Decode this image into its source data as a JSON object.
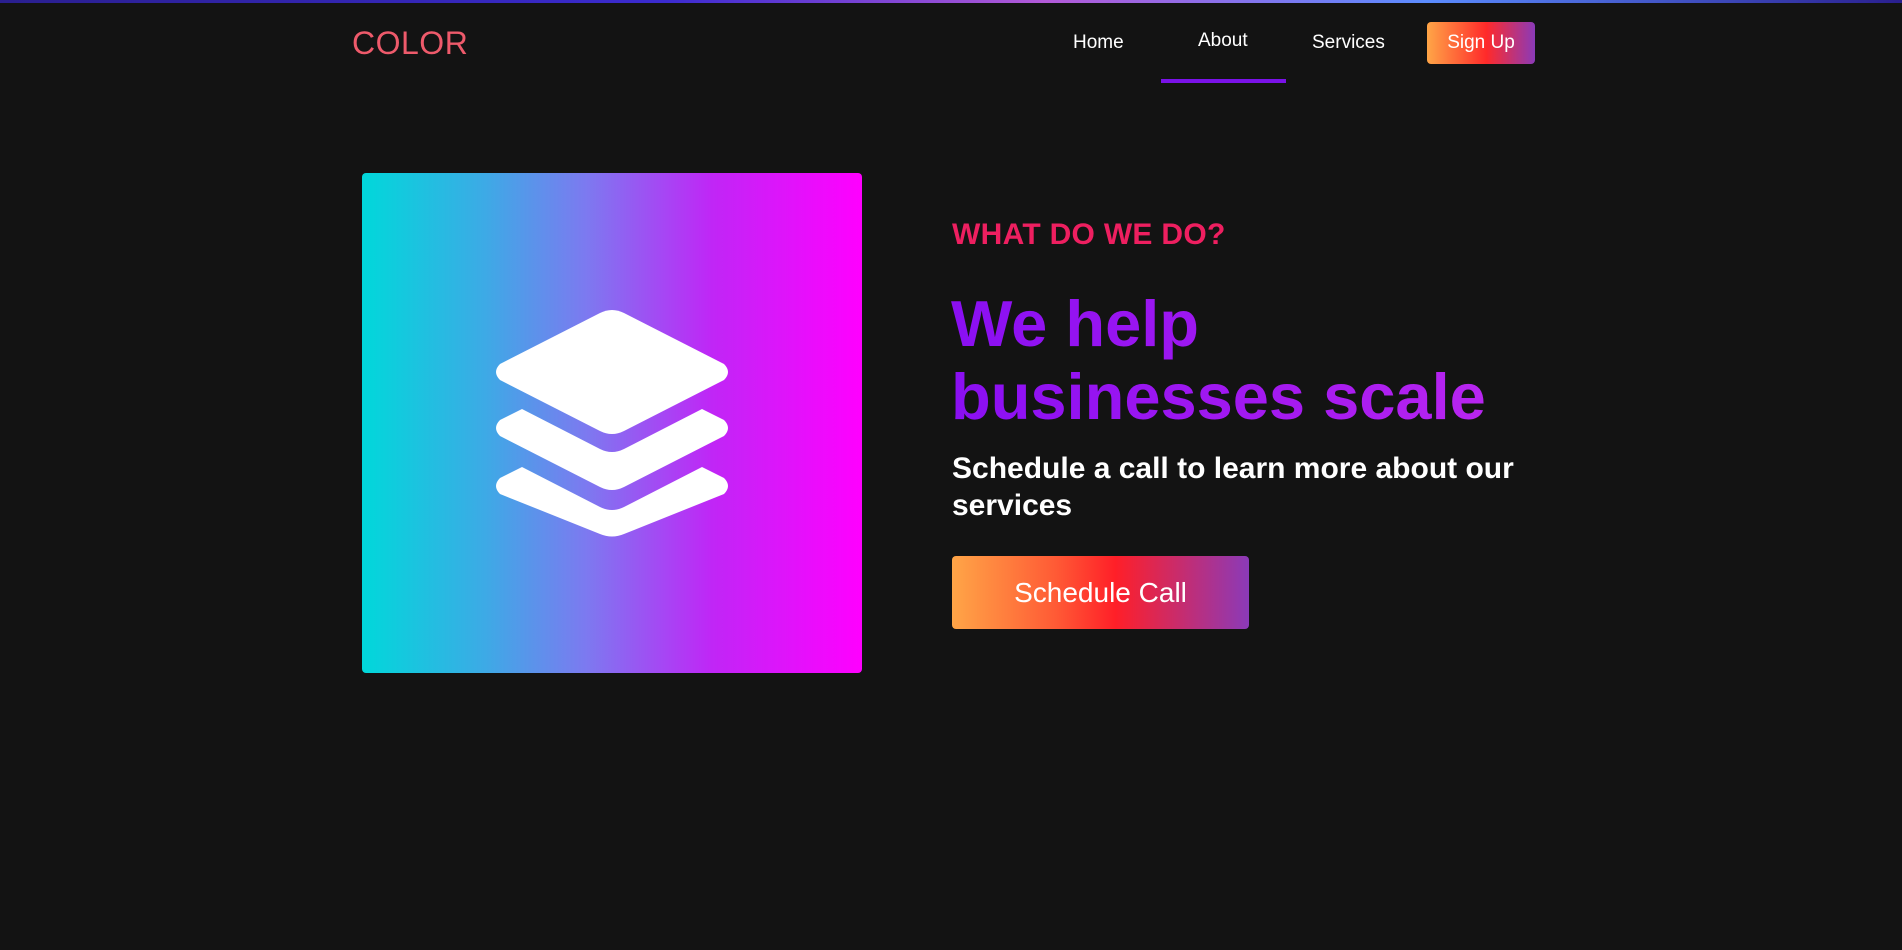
{
  "brand": {
    "logo_text": "COLOR",
    "logo_color": "#ee5a6b"
  },
  "nav": {
    "items": [
      {
        "label": "Home",
        "active": false
      },
      {
        "label": "About",
        "active": true
      },
      {
        "label": "Services",
        "active": false
      }
    ],
    "signup_label": "Sign Up",
    "active_indicator_color": "#7a12e8"
  },
  "hero": {
    "image_icon": "layers-icon",
    "eyebrow": "WHAT DO WE DO?",
    "eyebrow_color": "#ee1f60",
    "headline_line1": "We help",
    "headline_line2": "businesses scale",
    "headline_color": "#8a0ff2",
    "subtext": "Schedule a call to learn more about our services",
    "cta_label": "Schedule Call"
  },
  "colors": {
    "background": "#131313",
    "gradient_cyan": "#00d8da",
    "gradient_magenta": "#ff00ff",
    "button_orange": "#ffa547",
    "button_red": "#ff1f28",
    "button_purple": "#8b3ab8"
  }
}
